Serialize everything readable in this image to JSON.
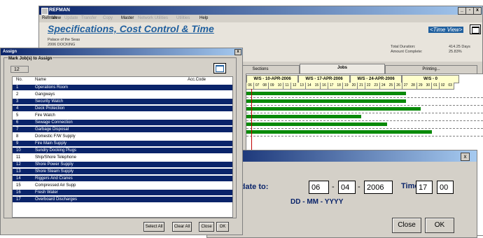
{
  "main_window": {
    "title": "REFMAN",
    "min_label": "_",
    "restore_label": "▫",
    "close_label": "x",
    "menu": [
      {
        "label": "Refman",
        "enabled": true
      },
      {
        "label": "View",
        "enabled": true
      },
      {
        "label": "Update",
        "enabled": false
      },
      {
        "label": "Transfer",
        "enabled": false
      },
      {
        "label": "Copy",
        "enabled": false
      },
      {
        "label": "Master",
        "enabled": true
      },
      {
        "label": "Network Utilities",
        "enabled": false
      },
      {
        "label": "Utilities",
        "enabled": false
      },
      {
        "label": "Help",
        "enabled": true
      }
    ]
  },
  "header": {
    "title": "Specifications, Cost Control & Time",
    "time_view": "<Time View>",
    "project_name": "Palace of the Seas",
    "project_sub": "2006 DOCKING",
    "total_duration_label": "Total Duration:",
    "total_duration_value": "414.25 Days",
    "amount_complete_label": "Amount Complete:",
    "amount_complete_value": "25.83%"
  },
  "tabs": [
    "Sections",
    "Jobs",
    "Printing..."
  ],
  "gantt": {
    "weeks": [
      "W/S - 10-APR-2006",
      "W/S - 17-APR-2006",
      "W/S - 24-APR-2006",
      "W/S - 0"
    ],
    "days": [
      "06",
      "07",
      "08",
      "09",
      "10",
      "11",
      "12",
      "13",
      "14",
      "15",
      "16",
      "17",
      "18",
      "19",
      "20",
      "21",
      "22",
      "23",
      "24",
      "25",
      "26",
      "27",
      "28",
      "29",
      "30",
      "01",
      "02",
      "03"
    ],
    "bars": [
      {
        "start": 0,
        "end": 21.5
      },
      {
        "start": 0,
        "end": 21.5
      },
      {
        "start": 0,
        "end": 23.5
      },
      {
        "start": 0,
        "end": 15.5
      },
      {
        "start": 0,
        "end": 19
      },
      {
        "start": 0,
        "end": 25
      }
    ]
  },
  "update_dialog": {
    "close_label": "x",
    "label": "Update to:",
    "day": "06",
    "month": "04",
    "year": "2006",
    "sep1": "-",
    "sep2": "-",
    "format": "DD - MM - YYYY",
    "time_label": "Time:",
    "hour": "17",
    "minute": "00",
    "close_button": "Close",
    "ok_button": "OK"
  },
  "assign_dialog": {
    "title": "Assign",
    "close_label": "x",
    "mark_label": "Mark Job(s) to Assign",
    "count": "12",
    "columns": {
      "no": "No.",
      "name": "Name",
      "acc_code": "Acc.Code"
    },
    "rows": [
      {
        "no": "1",
        "name": "Operations Room",
        "selected": true
      },
      {
        "no": "2",
        "name": "Gangways",
        "selected": false
      },
      {
        "no": "3",
        "name": "Security Watch",
        "selected": true
      },
      {
        "no": "4",
        "name": "Deck Protection",
        "selected": true
      },
      {
        "no": "5",
        "name": "Fire Watch",
        "selected": false
      },
      {
        "no": "6",
        "name": "Sewage Connection",
        "selected": true
      },
      {
        "no": "7",
        "name": "Garbage Disposal",
        "selected": true
      },
      {
        "no": "8",
        "name": "Domestic F/W Supply",
        "selected": false
      },
      {
        "no": "9",
        "name": "Fire Main Supply",
        "selected": true
      },
      {
        "no": "10",
        "name": "Sundry Docking Plugs",
        "selected": true
      },
      {
        "no": "11",
        "name": "Ship/Shore Telephone",
        "selected": false
      },
      {
        "no": "12",
        "name": "Shore Power Supply",
        "selected": true
      },
      {
        "no": "13",
        "name": "Shore Steam Supply",
        "selected": true
      },
      {
        "no": "14",
        "name": "Riggers And Cranes",
        "selected": true
      },
      {
        "no": "15",
        "name": "Compressed Air Supp",
        "selected": false
      },
      {
        "no": "16",
        "name": "Fresh Water",
        "selected": true
      },
      {
        "no": "17",
        "name": "Overboard Discharges",
        "selected": true
      }
    ],
    "buttons": {
      "select_all": "Select All",
      "clear_all": "Clear All",
      "close": "Close",
      "ok": "OK"
    }
  },
  "colors": {
    "selection": "#0a246a",
    "title_accent": "#1f5f9e",
    "gantt_bar": "#0a8a0a",
    "today_line": "#c00000",
    "week_header": "#ffffcc"
  }
}
